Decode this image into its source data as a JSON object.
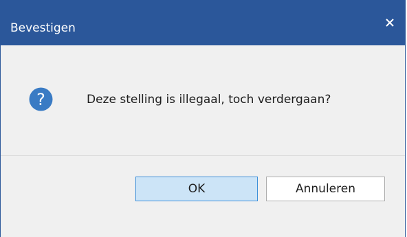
{
  "dialog": {
    "title": "Bevestigen",
    "message": "Deze stelling is illegaal, toch verdergaan?",
    "icon": "question-icon",
    "close_icon": "close-icon"
  },
  "buttons": {
    "ok_label": "OK",
    "cancel_label": "Annuleren"
  },
  "colors": {
    "titlebar": "#2b579a",
    "body": "#f0f0f0",
    "icon": "#3a7bc4",
    "default_button": "#cce4f7",
    "default_button_border": "#3b8fd9"
  }
}
